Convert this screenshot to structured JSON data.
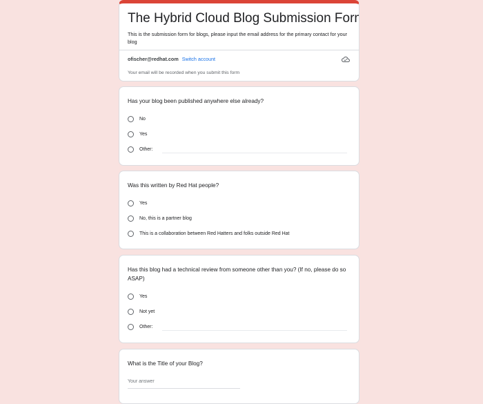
{
  "form": {
    "title": "The Hybrid Cloud Blog Submission Form",
    "description": "This is the submission form for blogs, please input the email address for the primary contact for your blog",
    "account_email": "ofischer@redhat.com",
    "switch_account_label": "Switch account",
    "record_note": "Your email will be recorded when you submit this form",
    "accent_color": "#db4437",
    "link_color": "#1a73e8",
    "background_color": "#f9e2e0"
  },
  "questions": [
    {
      "text": "Has your blog been published anywhere else already?",
      "options": [
        "No",
        "Yes",
        "Other:"
      ]
    },
    {
      "text": "Was this written by Red Hat people?",
      "options": [
        "Yes",
        "No, this is a partner blog",
        "This is a collaboration between Red Hatters and folks outside Red Hat"
      ]
    },
    {
      "text": "Has this blog had a technical review from someone other than you? (If no, please do so ASAP)",
      "options": [
        "Yes",
        "Not yet",
        "Other:"
      ]
    },
    {
      "text": "What is the Title of your Blog?",
      "answer_placeholder": "Your answer",
      "answer_value": ""
    }
  ],
  "icons": {
    "save_status": "cloud-done-icon",
    "radio": "radio-unchecked-icon"
  }
}
